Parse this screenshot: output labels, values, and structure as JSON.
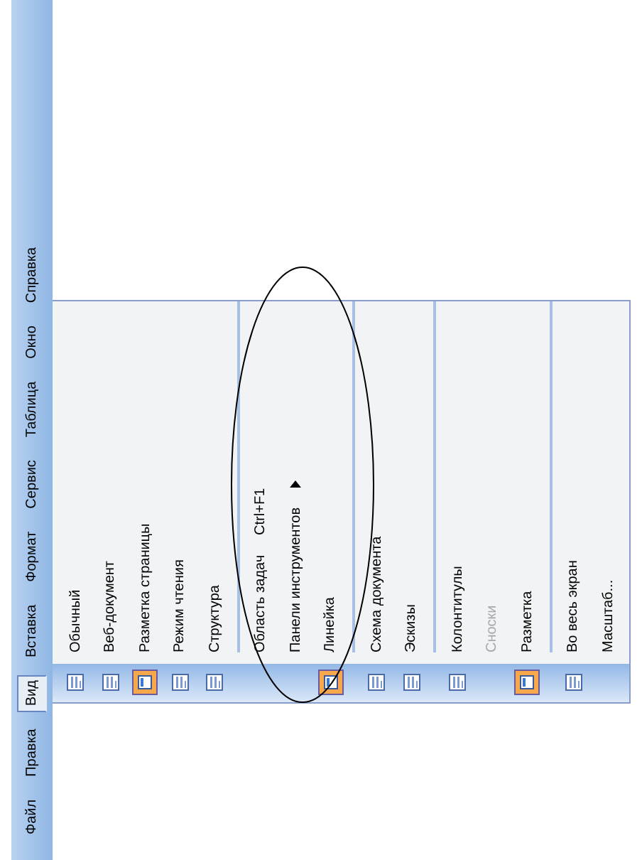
{
  "menu_bar": [
    {
      "label": "Файл",
      "selected": false
    },
    {
      "label": "Правка",
      "selected": false
    },
    {
      "label": "Вид",
      "selected": true
    },
    {
      "label": "Вставка",
      "selected": false
    },
    {
      "label": "Формат",
      "selected": false
    },
    {
      "label": "Сервис",
      "selected": false
    },
    {
      "label": "Таблица",
      "selected": false
    },
    {
      "label": "Окно",
      "selected": false
    },
    {
      "label": "Справка",
      "selected": false
    }
  ],
  "view_menu": {
    "groups": [
      {
        "items": [
          {
            "label": "Обычный",
            "icon": true,
            "checked": false,
            "disabled": false,
            "submenu": false
          },
          {
            "label": "Веб-документ",
            "icon": true,
            "checked": false,
            "disabled": false,
            "submenu": false
          },
          {
            "label": "Разметка страницы",
            "icon": true,
            "checked": true,
            "disabled": false,
            "submenu": false
          },
          {
            "label": "Режим чтения",
            "icon": true,
            "checked": false,
            "disabled": false,
            "submenu": false
          },
          {
            "label": "Структура",
            "icon": true,
            "checked": false,
            "disabled": false,
            "submenu": false
          }
        ]
      },
      {
        "items": [
          {
            "label": "Область задач",
            "shortcut": "Ctrl+F1",
            "icon": false,
            "checked": false,
            "disabled": false,
            "submenu": false
          },
          {
            "label": "Панели инструментов",
            "icon": false,
            "checked": false,
            "disabled": false,
            "submenu": true
          },
          {
            "label": "Линейка",
            "icon": true,
            "checked": true,
            "disabled": false,
            "submenu": false
          }
        ]
      },
      {
        "items": [
          {
            "label": "Схема документа",
            "icon": true,
            "checked": false,
            "disabled": false,
            "submenu": false
          },
          {
            "label": "Эскизы",
            "icon": true,
            "checked": false,
            "disabled": false,
            "submenu": false
          }
        ]
      },
      {
        "items": [
          {
            "label": "Колонтитулы",
            "icon": true,
            "checked": false,
            "disabled": false,
            "submenu": false
          },
          {
            "label": "Сноски",
            "icon": false,
            "checked": false,
            "disabled": true,
            "submenu": false
          },
          {
            "label": "Разметка",
            "icon": true,
            "checked": true,
            "disabled": false,
            "submenu": false
          }
        ]
      },
      {
        "items": [
          {
            "label": "Во весь экран",
            "icon": true,
            "checked": false,
            "disabled": false,
            "submenu": false
          },
          {
            "label": "Масштаб...",
            "icon": false,
            "checked": false,
            "disabled": false,
            "submenu": false
          }
        ]
      }
    ]
  }
}
